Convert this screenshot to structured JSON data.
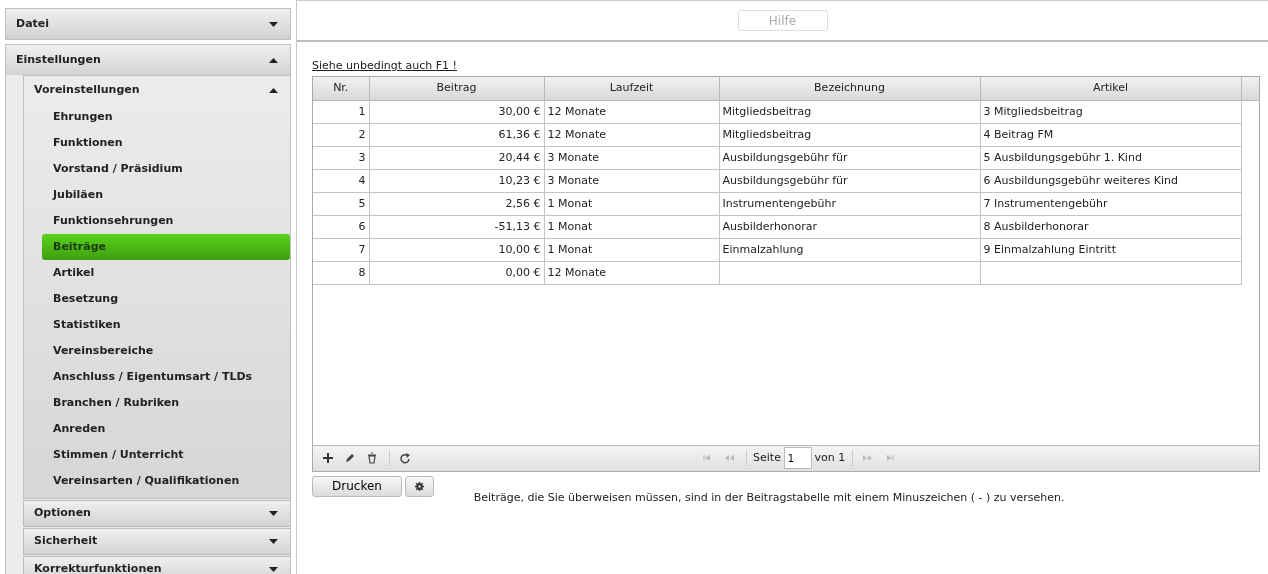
{
  "sidebar": {
    "sections": [
      {
        "label": "Datei",
        "expanded": false
      },
      {
        "label": "Einstellungen",
        "expanded": true,
        "groups": [
          {
            "label": "Voreinstellungen",
            "expanded": true,
            "items": [
              {
                "label": "Ehrungen",
                "selected": false
              },
              {
                "label": "Funktionen",
                "selected": false
              },
              {
                "label": "Vorstand / Präsidium",
                "selected": false
              },
              {
                "label": "Jubiläen",
                "selected": false
              },
              {
                "label": "Funktionsehrungen",
                "selected": false
              },
              {
                "label": "Beiträge",
                "selected": true
              },
              {
                "label": "Artikel",
                "selected": false
              },
              {
                "label": "Besetzung",
                "selected": false
              },
              {
                "label": "Statistiken",
                "selected": false
              },
              {
                "label": "Vereinsbereiche",
                "selected": false
              },
              {
                "label": "Anschluss / Eigentumsart / TLDs",
                "selected": false
              },
              {
                "label": "Branchen / Rubriken",
                "selected": false
              },
              {
                "label": "Anreden",
                "selected": false
              },
              {
                "label": "Stimmen / Unterricht",
                "selected": false
              },
              {
                "label": "Vereinsarten / Qualifikationen",
                "selected": false
              }
            ]
          },
          {
            "label": "Optionen",
            "expanded": false
          },
          {
            "label": "Sicherheit",
            "expanded": false
          },
          {
            "label": "Korrekturfunktionen",
            "expanded": false
          }
        ]
      }
    ]
  },
  "help_button": {
    "label": "Hilfe",
    "disabled": true
  },
  "hint_link": "Siehe unbedingt auch F1 !",
  "table": {
    "columns": [
      "Nr.",
      "Beitrag",
      "Laufzeit",
      "Bezeichnung",
      "Artikel"
    ],
    "rows": [
      [
        "1",
        "30,00 €",
        "12 Monate",
        "Mitgliedsbeitrag",
        "3 Mitgliedsbeitrag"
      ],
      [
        "2",
        "61,36 €",
        "12 Monate",
        "Mitgliedsbeitrag",
        "4 Beitrag FM"
      ],
      [
        "3",
        "20,44 €",
        "3 Monate",
        "Ausbildungsgebühr für",
        "5 Ausbildungsgebühr 1. Kind"
      ],
      [
        "4",
        "10,23 €",
        "3 Monate",
        "Ausbildungsgebühr für",
        "6 Ausbildungsgebühr weiteres Kind"
      ],
      [
        "5",
        "2,56 €",
        "1 Monat",
        "Instrumentengebühr",
        "7 Instrumentengebühr"
      ],
      [
        "6",
        "-51,13 €",
        "1 Monat",
        "Ausbilderhonorar",
        "8 Ausbilderhonorar"
      ],
      [
        "7",
        "10,00 €",
        "1 Monat",
        "Einmalzahlung",
        "9 Einmalzahlung Eintritt"
      ],
      [
        "8",
        "0,00 €",
        "12 Monate",
        "",
        ""
      ]
    ]
  },
  "pager": {
    "page_label": "Seite",
    "page": "1",
    "of_label": "von 1"
  },
  "print_button": "Drucken",
  "note": "Beiträge, die Sie überweisen müssen, sind in der Beitragstabelle mit einem Minuszeichen ( - ) zu versehen."
}
